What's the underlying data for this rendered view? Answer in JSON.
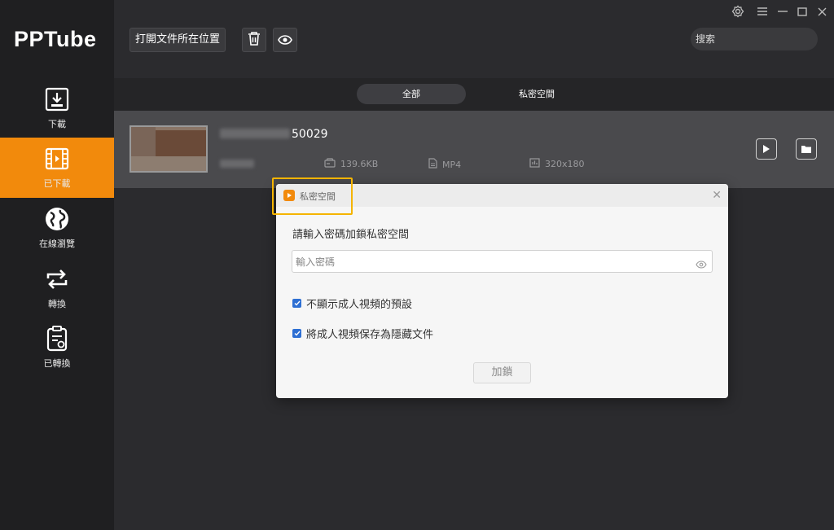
{
  "app": {
    "name": "PPTube"
  },
  "sidebar": {
    "items": [
      {
        "label": "下載",
        "icon": "download-icon"
      },
      {
        "label": "已下載",
        "icon": "film-icon",
        "active": true
      },
      {
        "label": "在線瀏覽",
        "icon": "globe-icon"
      },
      {
        "label": "轉換",
        "icon": "convert-icon"
      },
      {
        "label": "已轉換",
        "icon": "converted-doc-icon"
      }
    ]
  },
  "toolbar": {
    "open_folder_label": "打開文件所在位置",
    "delete_icon": "trash-icon",
    "preview_icon": "eye-icon",
    "search_placeholder": "搜索"
  },
  "window_controls": [
    "gear-icon",
    "menu-icon",
    "minimize-icon",
    "maximize-icon",
    "close-icon"
  ],
  "tabs": [
    {
      "label": "全部",
      "active": true
    },
    {
      "label": "私密空間",
      "active": false
    }
  ],
  "video": {
    "name_visible": "50029",
    "size": "139.6KB",
    "format": "MP4",
    "resolution": "320x180"
  },
  "dialog": {
    "title": "私密空間",
    "prompt": "請輸入密碼加鎖私密空間",
    "password_placeholder": "輸入密碼",
    "options": [
      {
        "label": "不顯示成人視頻的預設",
        "checked": true
      },
      {
        "label": "將成人視頻保存為隱藏文件",
        "checked": true
      }
    ],
    "lock_button": "加鎖"
  },
  "colors": {
    "accent": "#f28a0c",
    "sidebar_bg": "#1f1f21",
    "main_bg": "#2b2b2e",
    "checkbox": "#2d6fd3",
    "highlight": "#f5b400"
  }
}
